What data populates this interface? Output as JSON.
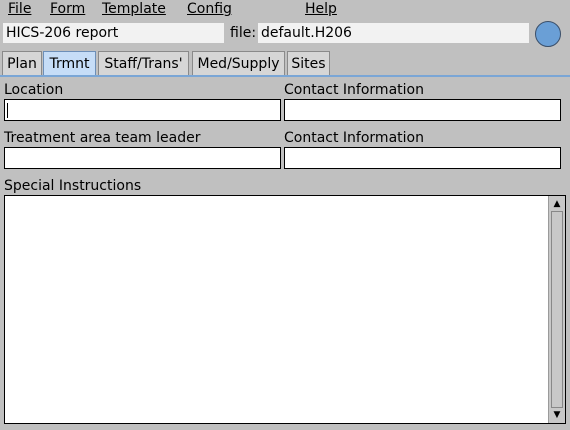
{
  "menu": {
    "file": "File",
    "form": "Form",
    "template": "Template",
    "config": "Config",
    "help": "Help"
  },
  "header": {
    "report_title": "HICS-206 report",
    "file_label": "file:",
    "file_name": "default.H206",
    "status_color": "#6a9fd6"
  },
  "tabs": {
    "plan": "Plan",
    "trmnt": "Trmnt",
    "staff": "Staff/Trans'",
    "med": "Med/Supply",
    "sites": "Sites",
    "active": "Trmnt"
  },
  "form": {
    "location_label": "Location",
    "location_value": "",
    "contact1_label": "Contact Information",
    "contact1_value": "",
    "leader_label": "Treatment area team leader",
    "leader_value": "",
    "contact2_label": "Contact Information",
    "contact2_value": "",
    "special_label": "Special Instructions",
    "special_value": ""
  }
}
